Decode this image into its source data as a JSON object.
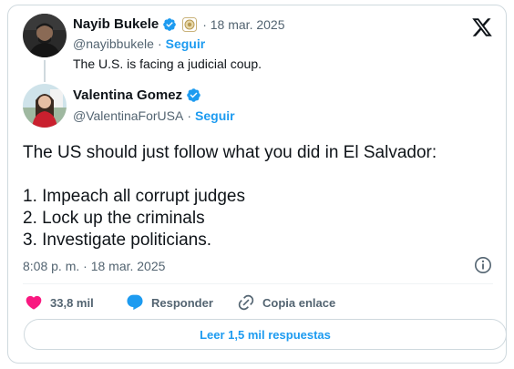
{
  "quoted_tweet": {
    "author_name": "Nayib Bukele",
    "handle": "@nayibbukele",
    "separator": "·",
    "follow_label": "Seguir",
    "date": "· 18 mar. 2025",
    "text": "The U.S. is facing a judicial coup."
  },
  "main_tweet": {
    "author_name": "Valentina Gomez",
    "handle": "@ValentinaForUSA",
    "separator": "·",
    "follow_label": "Seguir",
    "body_line1": "The US should just follow what you did in El Salvador:",
    "body_line2": "1. Impeach all corrupt judges",
    "body_line3": "2. Lock up the criminals",
    "body_line4": "3. Investigate politicians.",
    "timestamp": "8:08 p. m. · 18 mar. 2025"
  },
  "actions": {
    "likes_count": "33,8 mil",
    "reply_label": "Responder",
    "copy_link_label": "Copia enlace"
  },
  "replies_button": "Leer 1,5 mil respuestas",
  "icons": {
    "logo": "x-logo-icon",
    "verified": "verified-badge-icon",
    "gov_badge": "government-affiliation-badge-icon",
    "info": "info-icon",
    "like": "heart-icon",
    "reply": "speech-bubble-icon",
    "link": "link-icon"
  },
  "colors": {
    "accent": "#1d9bf0",
    "like": "#f91880",
    "text": "#0f1419",
    "muted": "#536471",
    "border": "#cfd9de"
  }
}
